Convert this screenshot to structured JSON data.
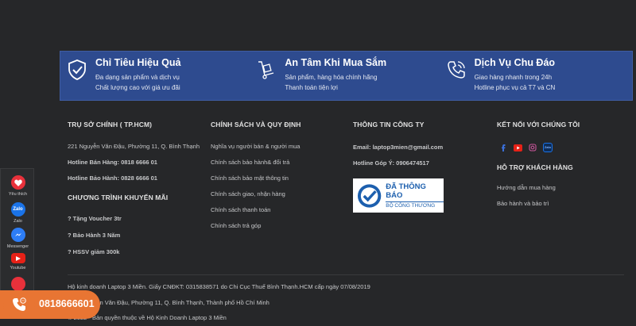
{
  "features": [
    {
      "icon": "shield-check-icon",
      "title": "Chỉ Tiêu Hiệu Quả",
      "line1": "Đa dạng sản phẩm và dịch vụ",
      "line2": "Chất lượng cao với giá ưu đãi"
    },
    {
      "icon": "hand-truck-icon",
      "title": "An Tâm Khi Mua Sắm",
      "line1": "Sản phẩm, hàng hóa chính hãng",
      "line2": "Thanh toán tiện lợi"
    },
    {
      "icon": "phone-ring-icon",
      "title": "Dịch Vụ Chu Đáo",
      "line1": "Giao hàng nhanh trong 24h",
      "line2": "Hotline phục vụ cả T7 và CN"
    }
  ],
  "hq": {
    "title": "TRỤ SỞ CHÍNH ( TP.HCM)",
    "address": "221 Nguyễn Văn Đậu, Phường 11, Q. Bình Thạnh",
    "hotline_sale": "Hotline Bán Hàng: 0818 6666 01",
    "hotline_warranty": "Hotline Bảo Hành: 0828 6666 01"
  },
  "promo": {
    "title": "CHƯƠNG TRÌNH KHUYẾN MÃI",
    "items": [
      "? Tặng Voucher 3tr",
      "? Bảo Hành 3 Năm",
      "? HSSV giảm 300k"
    ]
  },
  "policy": {
    "title": "CHÍNH SÁCH VÀ QUY ĐỊNH",
    "items": [
      "Nghĩa vụ người bán & người mua",
      "Chính sách bảo hành& đổi trả",
      "Chính sách bảo mật thông tin",
      "Chính sách giao, nhận hàng",
      "Chính sách thanh toán",
      "Chính sách trả góp"
    ]
  },
  "company": {
    "title": "THÔNG TIN CÔNG TY",
    "email": "Email: laptop3mien@gmail.com",
    "feedback": "Hotline Góp Ý: 0906474517",
    "badge_line1": "ĐÃ THÔNG BÁO",
    "badge_line2": "BỘ CÔNG THƯƠNG"
  },
  "connect": {
    "title": "KẾT NỐI VỚI CHÚNG TÔI",
    "zalo_text": "Zalo"
  },
  "support": {
    "title": "HỖ TRỢ KHÁCH HÀNG",
    "items": [
      "Hướng dẫn mua hàng",
      "Bảo hành và bảo trì"
    ]
  },
  "footer": {
    "license": "Hộ kinh doanh Laptop 3 Miền. Giấy CNĐKT: 0315838571 do Chi Cục Thuế Bình Thạnh.HCM cấp ngày 07/08/2019",
    "address": ": 221 Nguyễn Văn Đậu, Phường 11, Q. Bình Thạnh, Thành phố Hồ Chí Minh",
    "copyright": "© 2022 - Bản quyền thuộc về Hộ Kinh Doanh Laptop 3 Miền"
  },
  "sidebar": {
    "items": [
      {
        "label": "Yêu thích",
        "icon": "heart-icon",
        "color": "#e8313b"
      },
      {
        "label": "Zalo",
        "icon": "zalo-icon",
        "color": "#1a73e8"
      },
      {
        "label": "Messenger",
        "icon": "messenger-icon",
        "color": "#2d7df6"
      },
      {
        "label": "Youtube",
        "icon": "youtube-icon",
        "color": "#e62117"
      }
    ]
  },
  "hotline_float": {
    "number": "0818666601",
    "color": "#e87533"
  },
  "colors": {
    "banner": "#2e4b8f",
    "background": "#262729"
  }
}
